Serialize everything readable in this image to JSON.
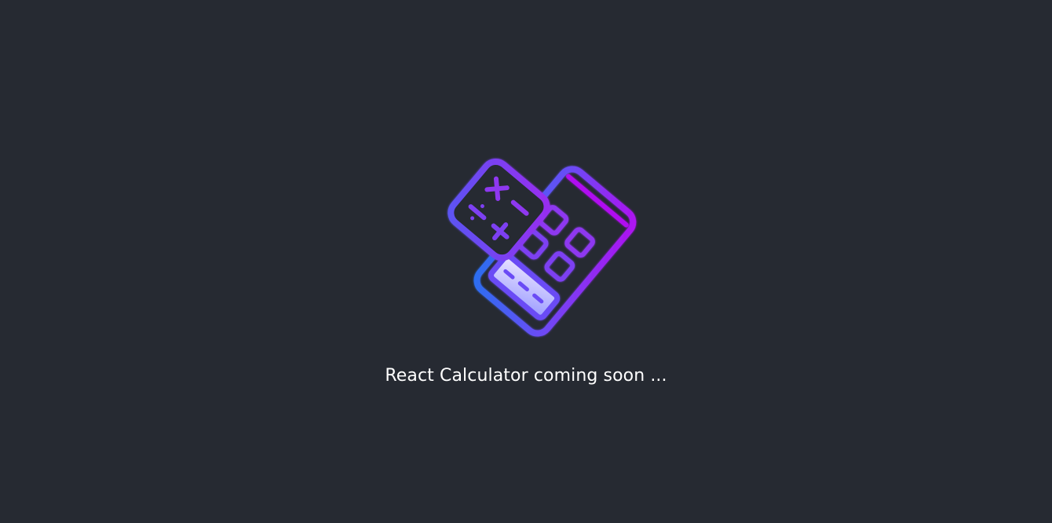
{
  "app": {
    "caption": "React Calculator coming soon ...",
    "logo_icon": "calculator-icon",
    "background_color": "#262a32",
    "accent_colors": {
      "gradient_start": "#2a6ff0",
      "gradient_mid": "#6a4cf5",
      "gradient_end": "#b010f0",
      "display_highlight": "#b9b3ff"
    }
  }
}
